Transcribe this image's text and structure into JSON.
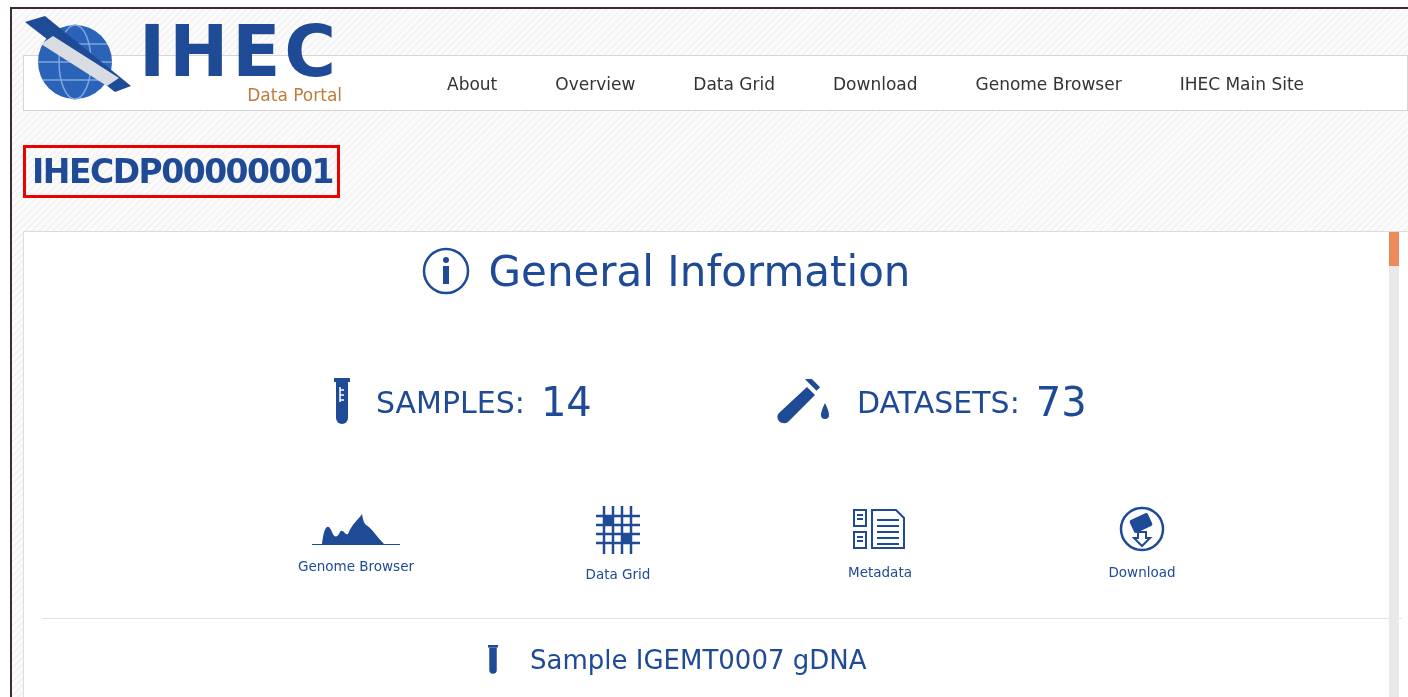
{
  "logo": {
    "title": "IHEC",
    "subtitle": "Data Portal"
  },
  "nav": [
    {
      "label": "About"
    },
    {
      "label": "Overview"
    },
    {
      "label": "Data Grid"
    },
    {
      "label": "Download"
    },
    {
      "label": "Genome Browser"
    },
    {
      "label": "IHEC Main Site"
    }
  ],
  "dataset_id": "IHECDP00000001",
  "general": {
    "heading": "General Information",
    "stats": [
      {
        "kind": "samples",
        "label": "SAMPLES:",
        "value": "14"
      },
      {
        "kind": "datasets",
        "label": "DATASETS:",
        "value": "73"
      }
    ],
    "links": [
      {
        "kind": "genome",
        "label": "Genome Browser"
      },
      {
        "kind": "grid",
        "label": "Data Grid"
      },
      {
        "kind": "metadata",
        "label": "Metadata"
      },
      {
        "kind": "download",
        "label": "Download"
      }
    ]
  },
  "sample": {
    "title": "Sample IGEMT0007 gDNA"
  }
}
